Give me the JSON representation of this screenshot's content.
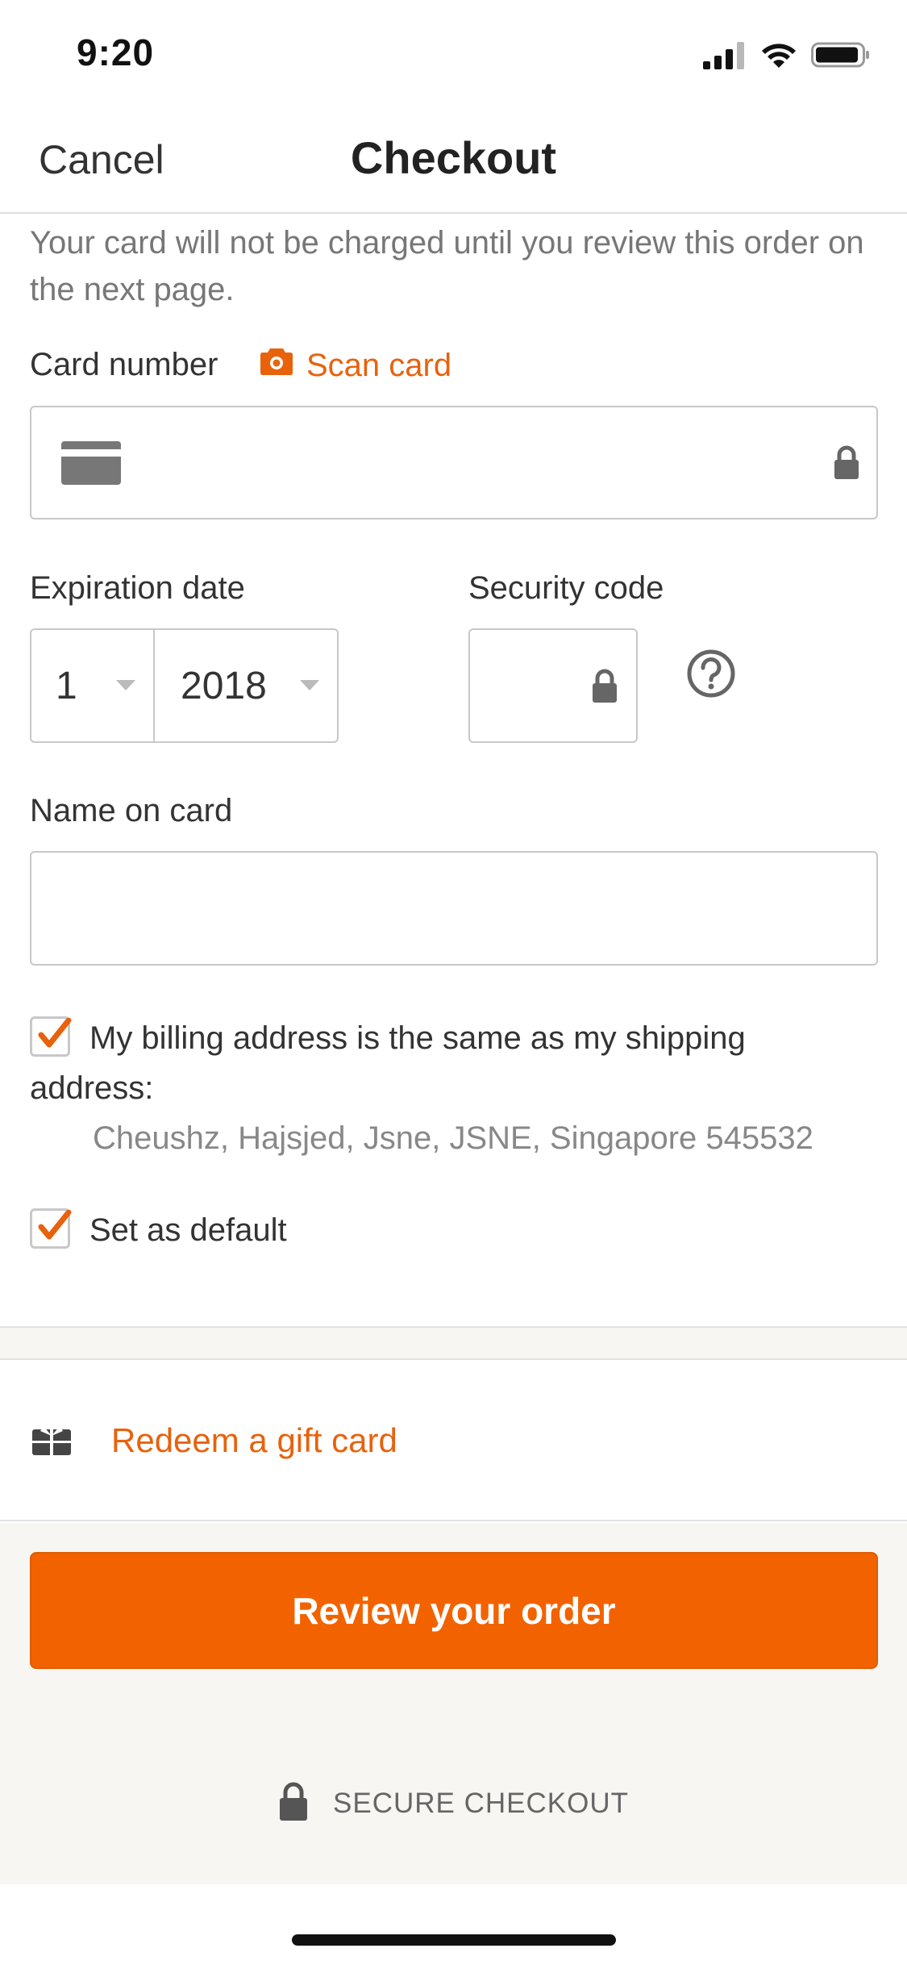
{
  "status_bar": {
    "time": "9:20",
    "icons": [
      "signal-icon",
      "wifi-icon",
      "battery-icon"
    ]
  },
  "nav": {
    "cancel_label": "Cancel",
    "title": "Checkout"
  },
  "notice": "Your card will not be charged until you review this order on the next page.",
  "card_number": {
    "label": "Card number",
    "scan_label": "Scan card",
    "value": "",
    "icons": [
      "credit-card-icon",
      "lock-icon",
      "camera-icon"
    ]
  },
  "expiration": {
    "label": "Expiration date",
    "month": "1",
    "year": "2018"
  },
  "security_code": {
    "label": "Security code",
    "value": "",
    "icons": [
      "lock-icon",
      "help-icon"
    ]
  },
  "name_on_card": {
    "label": "Name on card",
    "value": ""
  },
  "billing": {
    "checked": true,
    "label_line1": "My billing address is the same as my shipping",
    "label_line2": "address:",
    "address": "Cheushz, Hajsjed, Jsne, JSNE, Singapore 545532"
  },
  "set_default": {
    "checked": true,
    "label": "Set as default"
  },
  "gift_card": {
    "label": "Redeem a gift card",
    "icon": "gift-icon"
  },
  "cta": {
    "label": "Review your order"
  },
  "secure": {
    "label": "SECURE CHECKOUT",
    "icon": "lock-icon"
  },
  "colors": {
    "accent": "#e8620c",
    "button": "#f26300",
    "muted_text": "#777777",
    "border": "#c8c8c8",
    "band": "#f8f6f2"
  }
}
